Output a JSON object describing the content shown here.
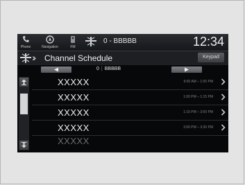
{
  "statusbar": {
    "phone_label": "Phone",
    "navigation_label": "Navigation",
    "fm_label": "FM",
    "now_playing": "0 - BBBBB",
    "clock": "12:34"
  },
  "titlebar": {
    "title": "Channel Schedule",
    "keypad_label": "Keypad"
  },
  "channel_nav": {
    "channel_number": "0",
    "channel_name": "BBBBB"
  },
  "schedule": [
    {
      "name": "XXXXX",
      "time": "9:00 AM – 1:00 PM"
    },
    {
      "name": "XXXXX",
      "time": "1:00 PM – 1:15 PM"
    },
    {
      "name": "XXXXX",
      "time": "1:15 PM – 3:00 PM"
    },
    {
      "name": "XXXXX",
      "time": "3:00 PM – 3:30 PM"
    },
    {
      "name": "XXXXX",
      "time": ""
    }
  ],
  "colors": {
    "screen_bg": "#07080a",
    "text_primary": "#eeeeee",
    "text_secondary": "#7f8286",
    "scroll_thumb": "#d4d6d8"
  }
}
